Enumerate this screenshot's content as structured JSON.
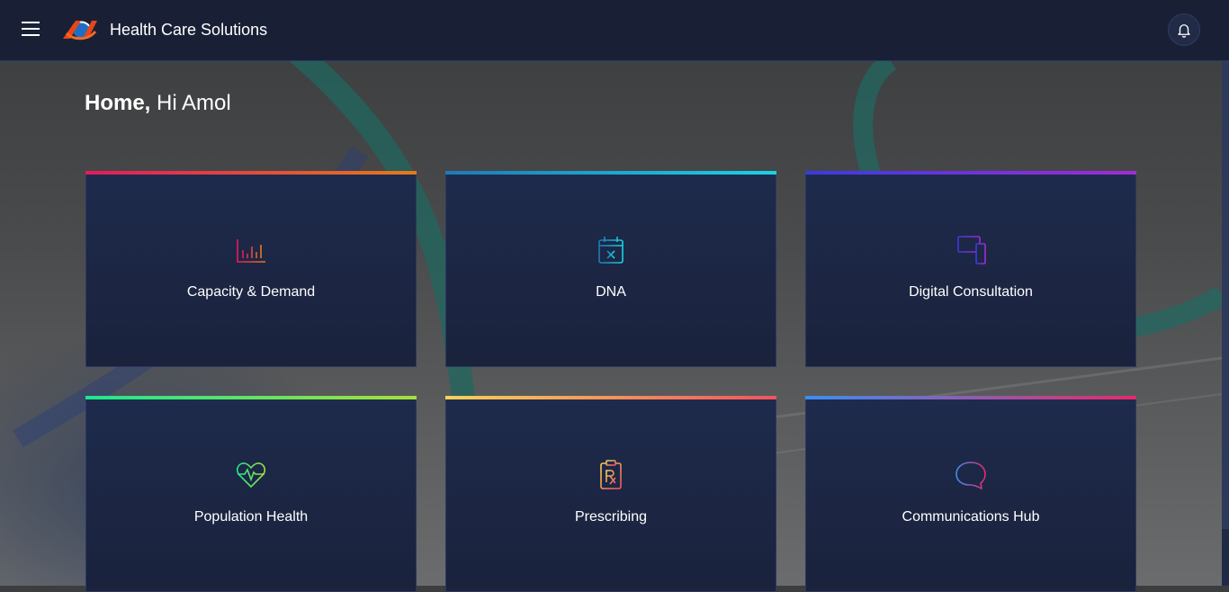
{
  "header": {
    "app_title": "Health Care Solutions",
    "menu_icon": "hamburger-menu-icon",
    "logo_icon": "brand-logo",
    "notification_icon": "bell-icon"
  },
  "greeting": {
    "page": "Home,",
    "text": "Hi Amol"
  },
  "cards": [
    {
      "label": "Capacity & Demand",
      "icon": "bar-chart-icon",
      "gradient": [
        "#e5195f",
        "#e57a1a"
      ]
    },
    {
      "label": "DNA",
      "icon": "calendar-cancel-icon",
      "gradient": [
        "#1d7bb8",
        "#19d3e6"
      ]
    },
    {
      "label": "Digital Consultation",
      "icon": "devices-icon",
      "gradient": [
        "#3a3be0",
        "#a32bd6"
      ]
    },
    {
      "label": "Population Health",
      "icon": "heart-pulse-icon",
      "gradient": [
        "#1ee68f",
        "#a6e03a"
      ]
    },
    {
      "label": "Prescribing",
      "icon": "prescription-clipboard-icon",
      "gradient": [
        "#f7d25a",
        "#f0545e"
      ]
    },
    {
      "label": "Communications Hub",
      "icon": "chat-bubble-icon",
      "gradient": [
        "#3b8ff0",
        "#e62a6b"
      ]
    }
  ]
}
